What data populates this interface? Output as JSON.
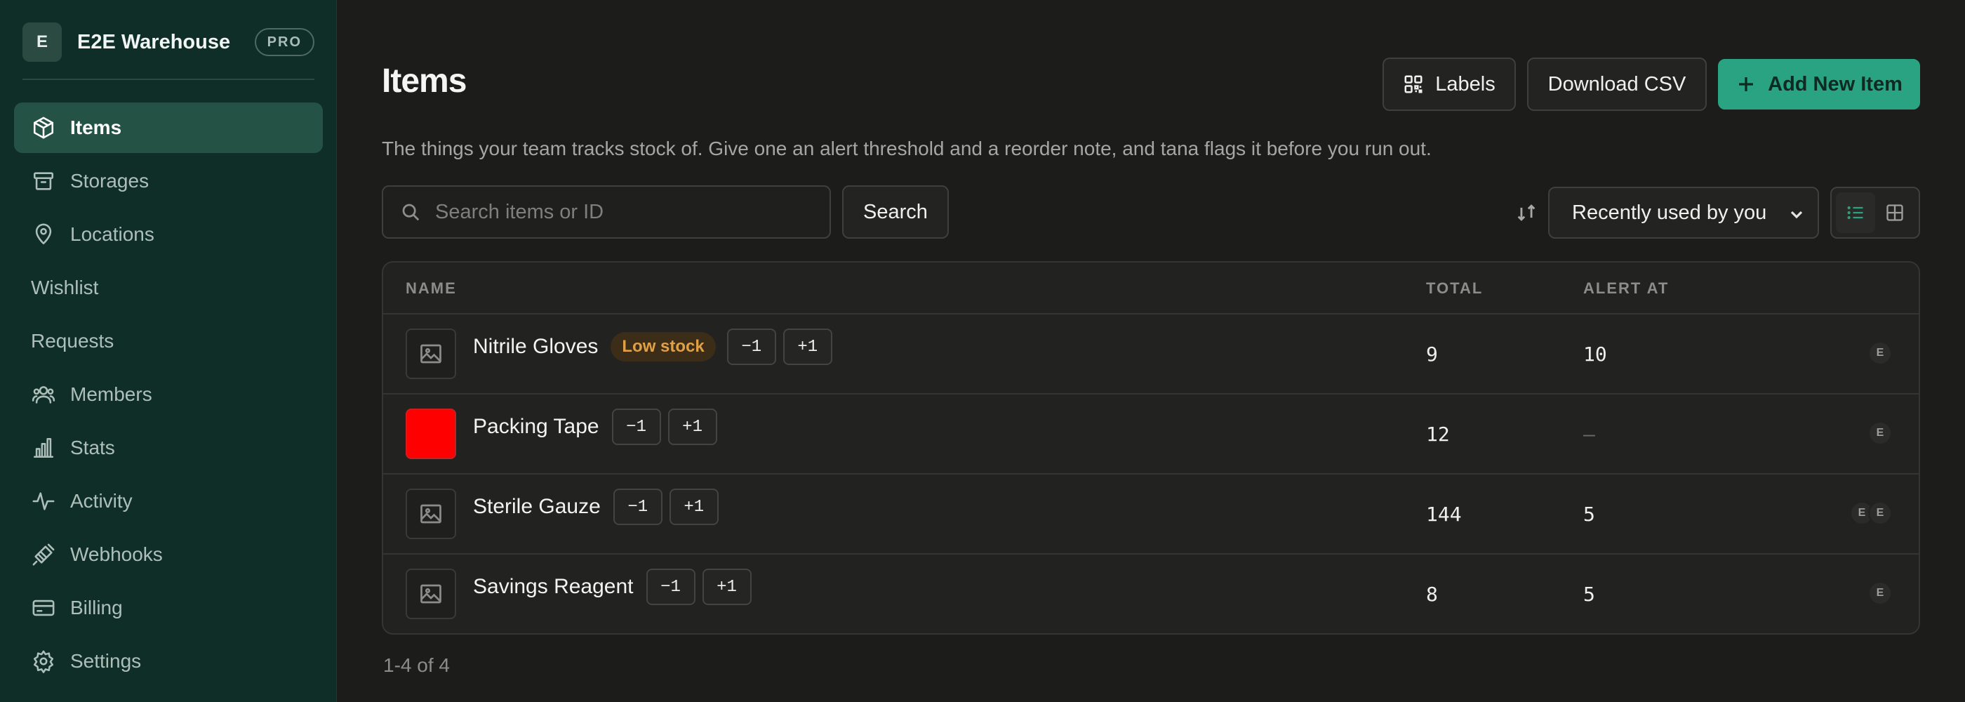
{
  "workspace": {
    "avatar": "E",
    "name": "E2E Warehouse",
    "badge": "PRO"
  },
  "sidebar": {
    "items": [
      {
        "label": "Items",
        "icon": "package-icon",
        "active": true
      },
      {
        "label": "Storages",
        "icon": "archive-icon"
      },
      {
        "label": "Locations",
        "icon": "map-pin-icon"
      },
      {
        "label": "Wishlist",
        "icon": ""
      },
      {
        "label": "Requests",
        "icon": ""
      },
      {
        "label": "Members",
        "icon": "users-icon"
      },
      {
        "label": "Stats",
        "icon": "bar-chart-icon"
      },
      {
        "label": "Activity",
        "icon": "activity-icon"
      },
      {
        "label": "Webhooks",
        "icon": "webhook-plug-icon"
      },
      {
        "label": "Billing",
        "icon": "credit-card-icon"
      },
      {
        "label": "Settings",
        "icon": "gear-icon"
      }
    ]
  },
  "page": {
    "title": "Items",
    "description": "The things your team tracks stock of. Give one an alert threshold and a reorder note, and tana flags it before you run out."
  },
  "toolbar": {
    "labels_button": "Labels",
    "download_button": "Download CSV",
    "add_button": "Add New Item",
    "search_placeholder": "Search items or ID",
    "search_button": "Search",
    "sort_value": "Recently used by you"
  },
  "table": {
    "columns": {
      "name": "NAME",
      "total": "TOTAL",
      "alert": "ALERT AT"
    },
    "decrement_label": "−1",
    "increment_label": "+1",
    "rows": [
      {
        "name": "Nitrile Gloves",
        "badge": "Low stock",
        "total": "9",
        "alert": "10",
        "avatars": [
          "E"
        ],
        "thumb": "image-placeholder"
      },
      {
        "name": "Packing Tape",
        "badge": "",
        "total": "12",
        "alert": "—",
        "avatars": [
          "E"
        ],
        "thumb": "color",
        "color": "#ff0000"
      },
      {
        "name": "Sterile Gauze",
        "badge": "",
        "total": "144",
        "alert": "5",
        "avatars": [
          "E",
          "E"
        ],
        "thumb": "image-placeholder"
      },
      {
        "name": "Savings Reagent",
        "badge": "",
        "total": "8",
        "alert": "5",
        "avatars": [
          "E"
        ],
        "thumb": "image-placeholder"
      }
    ]
  },
  "pagination": {
    "label": "1-4 of 4"
  },
  "colors": {
    "accent": "#2aa382",
    "sidebar_bg": "#0f2e27",
    "low_stock": "#e0a048"
  }
}
